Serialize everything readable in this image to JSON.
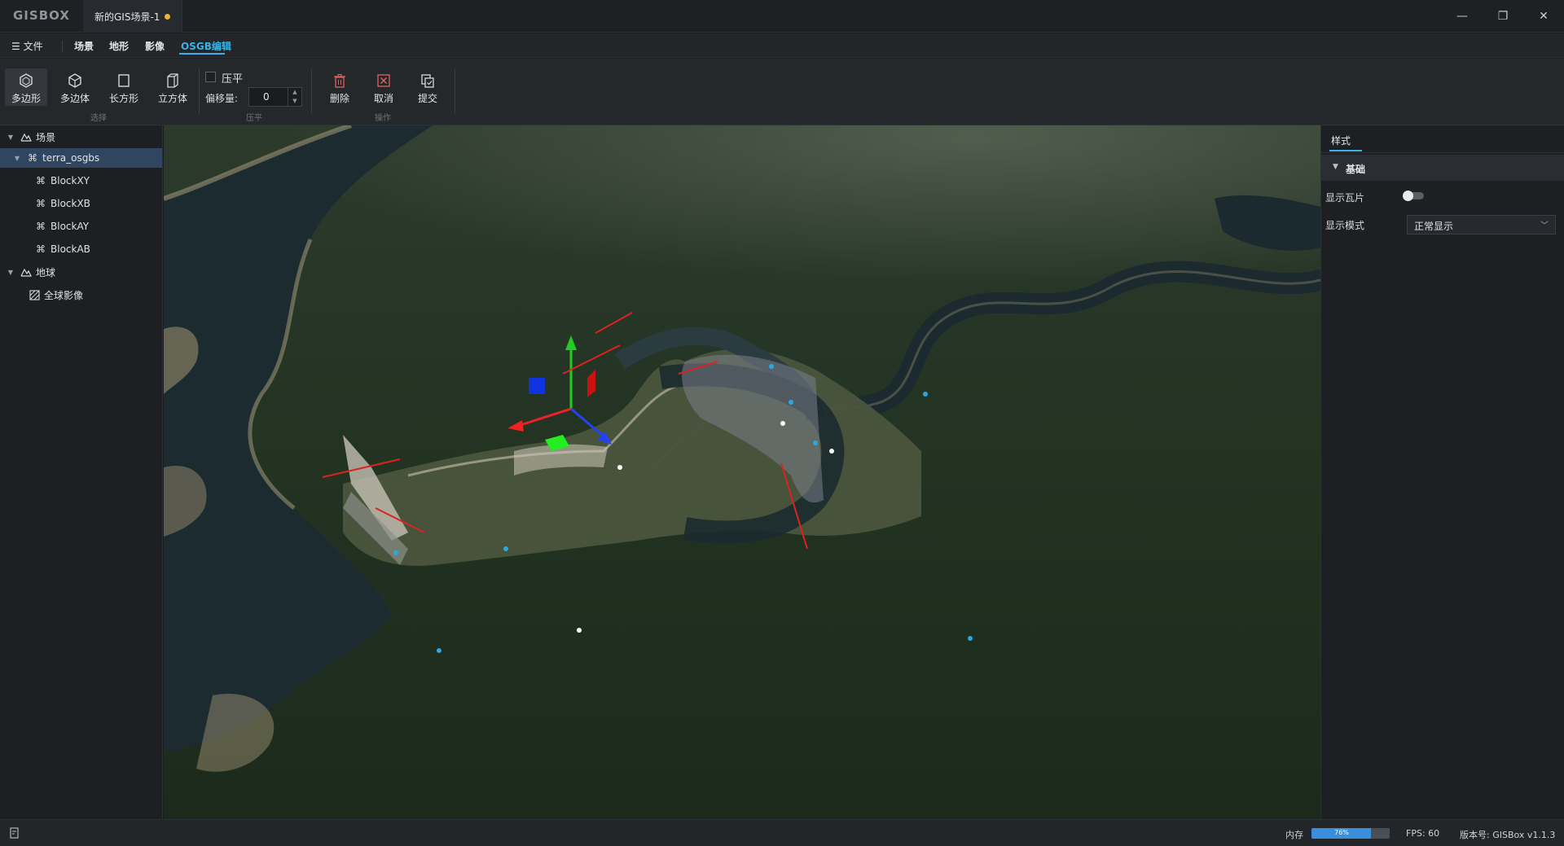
{
  "app": {
    "logo": "GISBOX",
    "document_tab": "新的GIS场景-1"
  },
  "window_controls": {
    "minimize": "—",
    "restore": "❐",
    "close": "✕"
  },
  "menu": {
    "file": "☰ 文件",
    "items": [
      "场景",
      "地形",
      "影像",
      "OSGB编辑"
    ],
    "active": "OSGB编辑"
  },
  "toolbar": {
    "select_group": {
      "label": "选择",
      "tools": [
        "多边形",
        "多边体",
        "长方形",
        "立方体"
      ],
      "selected": "多边形"
    },
    "flatten_group": {
      "label": "压平",
      "checkbox_label": "压平",
      "checked": false,
      "offset_label": "偏移量:",
      "offset_value": "0"
    },
    "action_group": {
      "label": "操作",
      "tools": [
        "删除",
        "取消",
        "提交"
      ]
    }
  },
  "tree": {
    "nodes": [
      {
        "label": "场景",
        "level": 0,
        "expanded": true,
        "icon": "scene-icon"
      },
      {
        "label": "terra_osgbs",
        "level": 1,
        "expanded": true,
        "selected": true,
        "icon": "model-icon"
      },
      {
        "label": "BlockXY",
        "level": 2,
        "icon": "block-icon"
      },
      {
        "label": "BlockXB",
        "level": 2,
        "icon": "block-icon"
      },
      {
        "label": "BlockAY",
        "level": 2,
        "icon": "block-icon"
      },
      {
        "label": "BlockAB",
        "level": 2,
        "icon": "block-icon"
      },
      {
        "label": "地球",
        "level": 0,
        "expanded": true,
        "icon": "earth-icon"
      },
      {
        "label": "全球影像",
        "level": 1,
        "icon": "imagery-icon"
      }
    ]
  },
  "right_panel": {
    "tab": "样式",
    "section": "基础",
    "show_tiles_label": "显示瓦片",
    "show_tiles_on": false,
    "display_mode_label": "显示模式",
    "display_mode_value": "正常显示"
  },
  "status": {
    "memory_label": "内存",
    "memory_percent": 76,
    "memory_text": "76%",
    "fps": "FPS: 60",
    "version": "版本号: GISBox v1.1.3"
  },
  "colors": {
    "accent": "#36b4e8",
    "selection": "#30455f",
    "warning_dot": "#f0b12c",
    "memory_fill": "#3a8fdc"
  }
}
